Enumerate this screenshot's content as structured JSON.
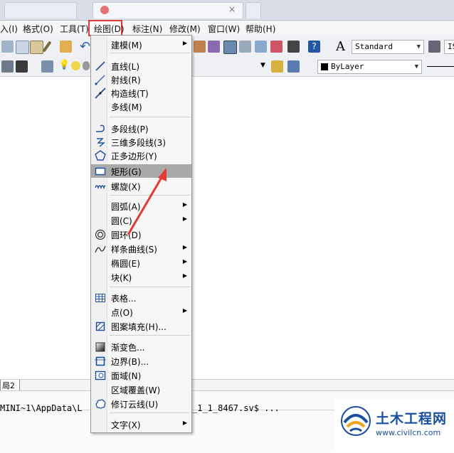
{
  "menubar": {
    "items": [
      {
        "label": "入(I)"
      },
      {
        "label": "格式(O)"
      },
      {
        "label": "工具(T)"
      },
      {
        "label": "绘图(D)"
      },
      {
        "label": "标注(N)"
      },
      {
        "label": "修改(M)"
      },
      {
        "label": "窗口(W)"
      },
      {
        "label": "帮助(H)"
      }
    ]
  },
  "toolbar": {
    "text_style": "Standard",
    "dim_style": "IS",
    "layer": "ByLayer"
  },
  "draw_menu": {
    "items": [
      {
        "label": "建模(M)",
        "submenu": true
      },
      {
        "label": "直线(L)"
      },
      {
        "label": "射线(R)"
      },
      {
        "label": "构造线(T)"
      },
      {
        "label": "多线(M)"
      },
      {
        "label": "多段线(P)"
      },
      {
        "label": "三维多段线(3)"
      },
      {
        "label": "正多边形(Y)"
      },
      {
        "label": "矩形(G)",
        "highlighted": true
      },
      {
        "label": "螺旋(X)"
      },
      {
        "label": "圆弧(A)",
        "submenu": true
      },
      {
        "label": "圆(C)",
        "submenu": true
      },
      {
        "label": "圆环(D)"
      },
      {
        "label": "样条曲线(S)",
        "submenu": true
      },
      {
        "label": "椭圆(E)",
        "submenu": true
      },
      {
        "label": "块(K)",
        "submenu": true
      },
      {
        "label": "表格..."
      },
      {
        "label": "点(O)",
        "submenu": true
      },
      {
        "label": "图案填充(H)..."
      },
      {
        "label": "渐变色..."
      },
      {
        "label": "边界(B)..."
      },
      {
        "label": "面域(N)"
      },
      {
        "label": "区域覆盖(W)"
      },
      {
        "label": "修订云线(U)"
      },
      {
        "label": "文字(X)",
        "submenu": true
      }
    ]
  },
  "layout_tab": "局2",
  "command_line": {
    "path_left": "MINI~1\\AppData\\L",
    "path_right": "_1_1_8467.sv$ ..."
  },
  "watermark": {
    "title": "土木工程网",
    "url": "www.civilcn.com"
  },
  "colors": {
    "highlight_box": "#e53935",
    "arrow": "#e53935",
    "menu_highlight": "#a9a9a9",
    "watermark_title": "#1a4fa0"
  }
}
